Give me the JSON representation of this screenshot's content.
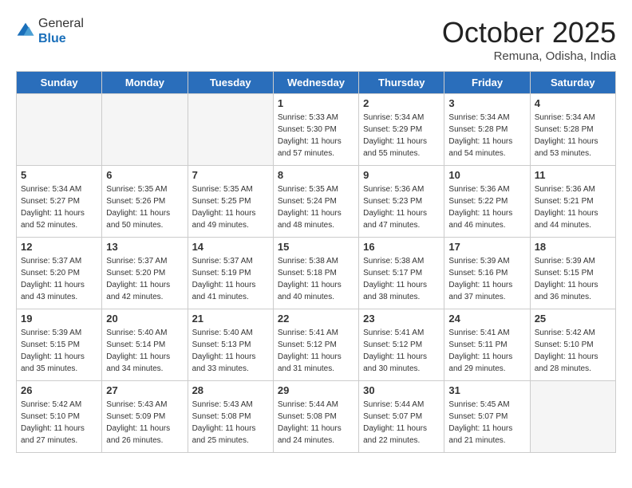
{
  "header": {
    "logo_line1": "General",
    "logo_line2": "Blue",
    "month": "October 2025",
    "location": "Remuna, Odisha, India"
  },
  "weekdays": [
    "Sunday",
    "Monday",
    "Tuesday",
    "Wednesday",
    "Thursday",
    "Friday",
    "Saturday"
  ],
  "weeks": [
    [
      {
        "day": "",
        "empty": true
      },
      {
        "day": "",
        "empty": true
      },
      {
        "day": "",
        "empty": true
      },
      {
        "day": "1",
        "sunrise": "5:33 AM",
        "sunset": "5:30 PM",
        "daylight": "11 hours and 57 minutes."
      },
      {
        "day": "2",
        "sunrise": "5:34 AM",
        "sunset": "5:29 PM",
        "daylight": "11 hours and 55 minutes."
      },
      {
        "day": "3",
        "sunrise": "5:34 AM",
        "sunset": "5:28 PM",
        "daylight": "11 hours and 54 minutes."
      },
      {
        "day": "4",
        "sunrise": "5:34 AM",
        "sunset": "5:28 PM",
        "daylight": "11 hours and 53 minutes."
      }
    ],
    [
      {
        "day": "5",
        "sunrise": "5:34 AM",
        "sunset": "5:27 PM",
        "daylight": "11 hours and 52 minutes."
      },
      {
        "day": "6",
        "sunrise": "5:35 AM",
        "sunset": "5:26 PM",
        "daylight": "11 hours and 50 minutes."
      },
      {
        "day": "7",
        "sunrise": "5:35 AM",
        "sunset": "5:25 PM",
        "daylight": "11 hours and 49 minutes."
      },
      {
        "day": "8",
        "sunrise": "5:35 AM",
        "sunset": "5:24 PM",
        "daylight": "11 hours and 48 minutes."
      },
      {
        "day": "9",
        "sunrise": "5:36 AM",
        "sunset": "5:23 PM",
        "daylight": "11 hours and 47 minutes."
      },
      {
        "day": "10",
        "sunrise": "5:36 AM",
        "sunset": "5:22 PM",
        "daylight": "11 hours and 46 minutes."
      },
      {
        "day": "11",
        "sunrise": "5:36 AM",
        "sunset": "5:21 PM",
        "daylight": "11 hours and 44 minutes."
      }
    ],
    [
      {
        "day": "12",
        "sunrise": "5:37 AM",
        "sunset": "5:20 PM",
        "daylight": "11 hours and 43 minutes."
      },
      {
        "day": "13",
        "sunrise": "5:37 AM",
        "sunset": "5:20 PM",
        "daylight": "11 hours and 42 minutes."
      },
      {
        "day": "14",
        "sunrise": "5:37 AM",
        "sunset": "5:19 PM",
        "daylight": "11 hours and 41 minutes."
      },
      {
        "day": "15",
        "sunrise": "5:38 AM",
        "sunset": "5:18 PM",
        "daylight": "11 hours and 40 minutes."
      },
      {
        "day": "16",
        "sunrise": "5:38 AM",
        "sunset": "5:17 PM",
        "daylight": "11 hours and 38 minutes."
      },
      {
        "day": "17",
        "sunrise": "5:39 AM",
        "sunset": "5:16 PM",
        "daylight": "11 hours and 37 minutes."
      },
      {
        "day": "18",
        "sunrise": "5:39 AM",
        "sunset": "5:15 PM",
        "daylight": "11 hours and 36 minutes."
      }
    ],
    [
      {
        "day": "19",
        "sunrise": "5:39 AM",
        "sunset": "5:15 PM",
        "daylight": "11 hours and 35 minutes."
      },
      {
        "day": "20",
        "sunrise": "5:40 AM",
        "sunset": "5:14 PM",
        "daylight": "11 hours and 34 minutes."
      },
      {
        "day": "21",
        "sunrise": "5:40 AM",
        "sunset": "5:13 PM",
        "daylight": "11 hours and 33 minutes."
      },
      {
        "day": "22",
        "sunrise": "5:41 AM",
        "sunset": "5:12 PM",
        "daylight": "11 hours and 31 minutes."
      },
      {
        "day": "23",
        "sunrise": "5:41 AM",
        "sunset": "5:12 PM",
        "daylight": "11 hours and 30 minutes."
      },
      {
        "day": "24",
        "sunrise": "5:41 AM",
        "sunset": "5:11 PM",
        "daylight": "11 hours and 29 minutes."
      },
      {
        "day": "25",
        "sunrise": "5:42 AM",
        "sunset": "5:10 PM",
        "daylight": "11 hours and 28 minutes."
      }
    ],
    [
      {
        "day": "26",
        "sunrise": "5:42 AM",
        "sunset": "5:10 PM",
        "daylight": "11 hours and 27 minutes."
      },
      {
        "day": "27",
        "sunrise": "5:43 AM",
        "sunset": "5:09 PM",
        "daylight": "11 hours and 26 minutes."
      },
      {
        "day": "28",
        "sunrise": "5:43 AM",
        "sunset": "5:08 PM",
        "daylight": "11 hours and 25 minutes."
      },
      {
        "day": "29",
        "sunrise": "5:44 AM",
        "sunset": "5:08 PM",
        "daylight": "11 hours and 24 minutes."
      },
      {
        "day": "30",
        "sunrise": "5:44 AM",
        "sunset": "5:07 PM",
        "daylight": "11 hours and 22 minutes."
      },
      {
        "day": "31",
        "sunrise": "5:45 AM",
        "sunset": "5:07 PM",
        "daylight": "11 hours and 21 minutes."
      },
      {
        "day": "",
        "empty": true
      }
    ]
  ]
}
